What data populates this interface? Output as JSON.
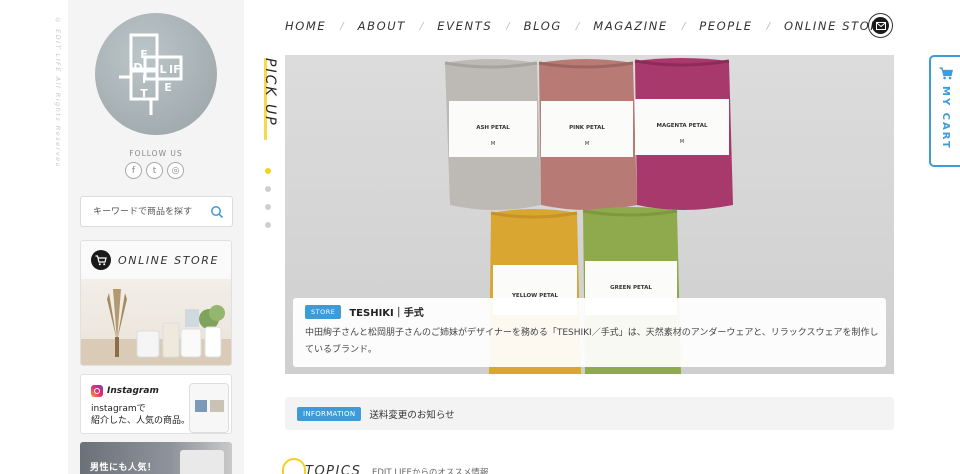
{
  "copyright": "© EDIT LIFE All Rights Reserved",
  "sidebar": {
    "logo_text": "EDIT LIFE",
    "follow_label": "FOLLOW US",
    "social": [
      {
        "icon": "facebook-icon",
        "glyph": "f"
      },
      {
        "icon": "twitter-icon",
        "glyph": "t"
      },
      {
        "icon": "instagram-icon",
        "glyph": "◎"
      }
    ],
    "search_placeholder": "キーワードで商品を探す",
    "store_banner_title": "ONLINE STORE",
    "instagram_banner": {
      "name": "Instagram",
      "text_line1": "instagramで",
      "text_line2": "紹介した、人気の商品。"
    },
    "men_banner_text": "男性にも人気！"
  },
  "nav": {
    "items": [
      "HOME",
      "ABOUT",
      "EVENTS",
      "BLOG",
      "MAGAZINE",
      "PEOPLE",
      "ONLINE STORE"
    ],
    "active": "HOME"
  },
  "pickup_label": "PICK UP",
  "hero": {
    "products": [
      "ASH PETAL",
      "PINK PETAL",
      "MAGENTA PETAL",
      "YELLOW PETAL",
      "GREEN PETAL"
    ],
    "size_label": "M",
    "tag": "STORE",
    "title": "TESHIKI｜手式",
    "body": "中田絢子さんと松岡朋子さんのご姉妹がデザイナーを務める「TESHIKI／手式」は、天然素材のアンダーウェアと、リラックスウェアを制作しているブランド。"
  },
  "info": {
    "tag": "INFORMATION",
    "text": "送料変更のお知らせ"
  },
  "topics": {
    "title": "TOPICS",
    "subtitle": "EDIT LIFEからのオススメ情報"
  },
  "mycart_label": "MY CART",
  "colors": {
    "accent_yellow": "#f5d11d",
    "accent_blue": "#3f9ad8"
  }
}
